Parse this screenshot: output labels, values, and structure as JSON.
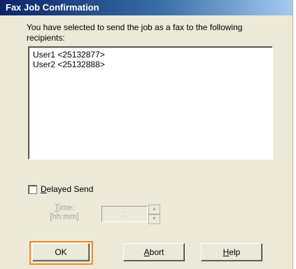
{
  "dialog": {
    "title": "Fax Job Confirmation",
    "message": "You have selected to send the job as a fax to the following recipients:",
    "recipients": [
      "User1 <25132877>",
      "User2 <25132888>"
    ]
  },
  "delayed_send": {
    "checked": false,
    "label_accel": "D",
    "label_rest": "elayed Send",
    "time_label_line1_accel": "T",
    "time_label_line1_rest": "ime:",
    "time_label_line2": "[hh:mm]",
    "time_value": ":",
    "spin_up": "▲",
    "spin_down": "▼"
  },
  "buttons": {
    "ok": "OK",
    "abort_accel": "A",
    "abort_rest": "bort",
    "help_accel": "H",
    "help_rest": "elp"
  },
  "colors": {
    "focus_ring": "#f28b2c",
    "title_bar_start": "#0a246a",
    "dialog_bg": "#ece9d8"
  }
}
